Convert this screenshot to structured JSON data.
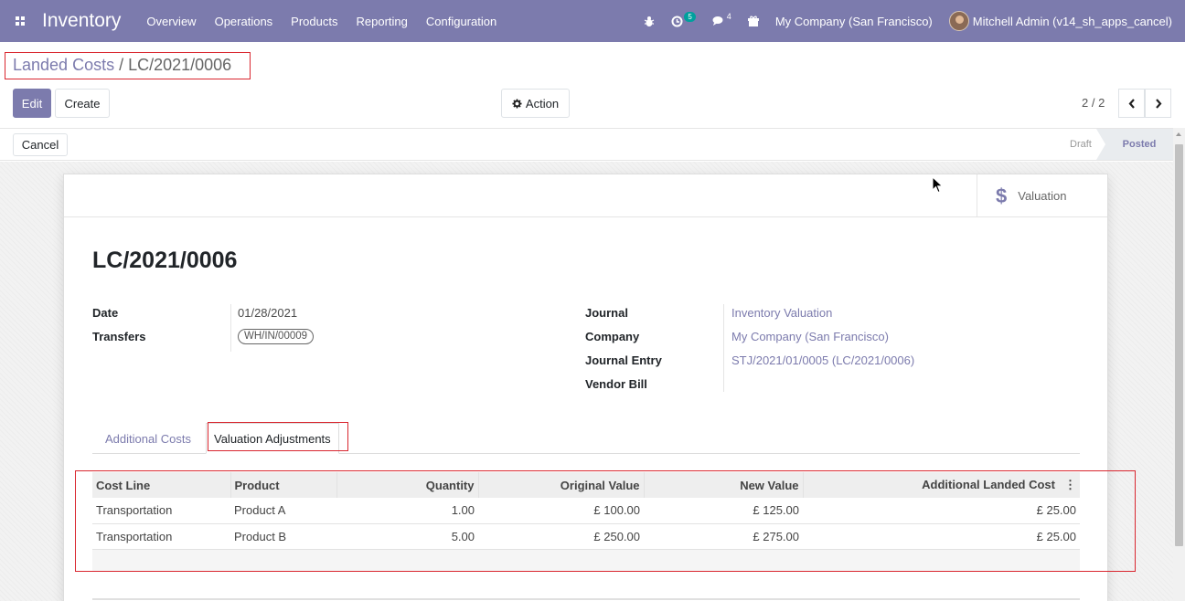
{
  "nav": {
    "app_name": "Inventory",
    "menu": [
      "Overview",
      "Operations",
      "Products",
      "Reporting",
      "Configuration"
    ],
    "activity_count": "5",
    "messages_count": "4",
    "company": "My Company (San Francisco)",
    "user": "Mitchell Admin (v14_sh_apps_cancel)"
  },
  "breadcrumb": {
    "parent": "Landed Costs",
    "separator": " / ",
    "current": "LC/2021/0006"
  },
  "buttons": {
    "edit": "Edit",
    "create": "Create",
    "action": "Action",
    "cancel": "Cancel"
  },
  "pager": {
    "value": "2 / 2"
  },
  "statusbar": {
    "draft": "Draft",
    "posted": "Posted",
    "active": "Posted"
  },
  "smart_button": {
    "label": "Valuation",
    "icon": "dollar-icon"
  },
  "record": {
    "name": "LC/2021/0006",
    "date_label": "Date",
    "date": "01/28/2021",
    "transfers_label": "Transfers",
    "transfer_tag": "WH/IN/00009",
    "journal_label": "Journal",
    "journal": "Inventory Valuation",
    "company_label": "Company",
    "company": "My Company (San Francisco)",
    "journal_entry_label": "Journal Entry",
    "journal_entry": "STJ/2021/01/0005 (LC/2021/0006)",
    "vendor_bill_label": "Vendor Bill"
  },
  "tabs": {
    "additional_costs": "Additional Costs",
    "valuation_adjustments": "Valuation Adjustments",
    "active": "Valuation Adjustments"
  },
  "table": {
    "columns": [
      "Cost Line",
      "Product",
      "Quantity",
      "Original Value",
      "New Value",
      "Additional Landed Cost"
    ],
    "rows": [
      [
        "Transportation",
        "Product A",
        "1.00",
        "£ 100.00",
        "£ 125.00",
        "£ 25.00"
      ],
      [
        "Transportation",
        "Product B",
        "5.00",
        "£ 250.00",
        "£ 275.00",
        "£ 25.00"
      ]
    ]
  },
  "colors": {
    "brand": "#7c7bad",
    "highlight_box": "#d9262f",
    "badge": "#00a09d"
  }
}
